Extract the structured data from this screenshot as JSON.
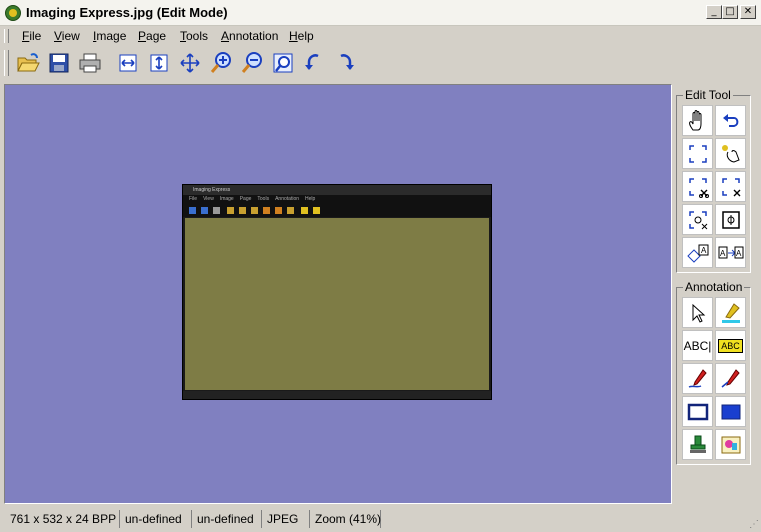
{
  "window": {
    "title": "Imaging Express.jpg (Edit Mode)",
    "minimize": "_",
    "maximize": "□",
    "close": "✕"
  },
  "menu": {
    "items": [
      {
        "label": "File",
        "accel": "F",
        "rest": "ile"
      },
      {
        "label": "View",
        "accel": "V",
        "rest": "iew"
      },
      {
        "label": "Image",
        "accel": "I",
        "rest": "mage"
      },
      {
        "label": "Page",
        "accel": "P",
        "rest": "age"
      },
      {
        "label": "Tools",
        "accel": "T",
        "rest": "ools"
      },
      {
        "label": "Annotation",
        "accel": "A",
        "rest": "nnotation"
      },
      {
        "label": "Help",
        "accel": "H",
        "rest": "elp"
      }
    ]
  },
  "toolbar": {
    "icons": [
      "open-folder-icon",
      "save-disk-icon",
      "printer-icon",
      "fit-width-icon",
      "fit-height-icon",
      "fit-window-icon",
      "zoom-in-icon",
      "zoom-out-icon",
      "zoom-fit-icon",
      "rotate-left-icon",
      "rotate-right-icon"
    ]
  },
  "thumbnail": {
    "title": "Imaging Express",
    "menu": [
      "File",
      "View",
      "Image",
      "Page",
      "Tools",
      "Annotation",
      "Help"
    ]
  },
  "edit_tool": {
    "label": "Edit Tool",
    "icons": [
      "hand-pan-icon",
      "undo-icon",
      "rect-select-icon",
      "lasso-select-icon",
      "crop-rect-icon",
      "crop-rect-alt-icon",
      "select-copy-icon",
      "select-paste-icon",
      "transform-text-icon",
      "text-replace-icon"
    ]
  },
  "annotation": {
    "label": "Annotation",
    "icons": [
      "pointer-icon",
      "highlighter-icon",
      "text-tool-icon",
      "text-box-icon",
      "freehand-pen-icon",
      "line-pen-icon",
      "rectangle-outline-icon",
      "rectangle-filled-icon",
      "stamp-icon",
      "image-insert-icon"
    ],
    "text_tool_label": "ABC",
    "text_box_label": "ABC"
  },
  "status": {
    "dimensions": "761 x 532 x 24 BPP",
    "field2": "un-defined",
    "field3": "un-defined",
    "format": "JPEG",
    "zoom": "Zoom (41%)"
  },
  "colors": {
    "canvas_bg": "#8080c0",
    "image_fill": "#7e7c45",
    "accent_blue": "#1a3fbf"
  }
}
